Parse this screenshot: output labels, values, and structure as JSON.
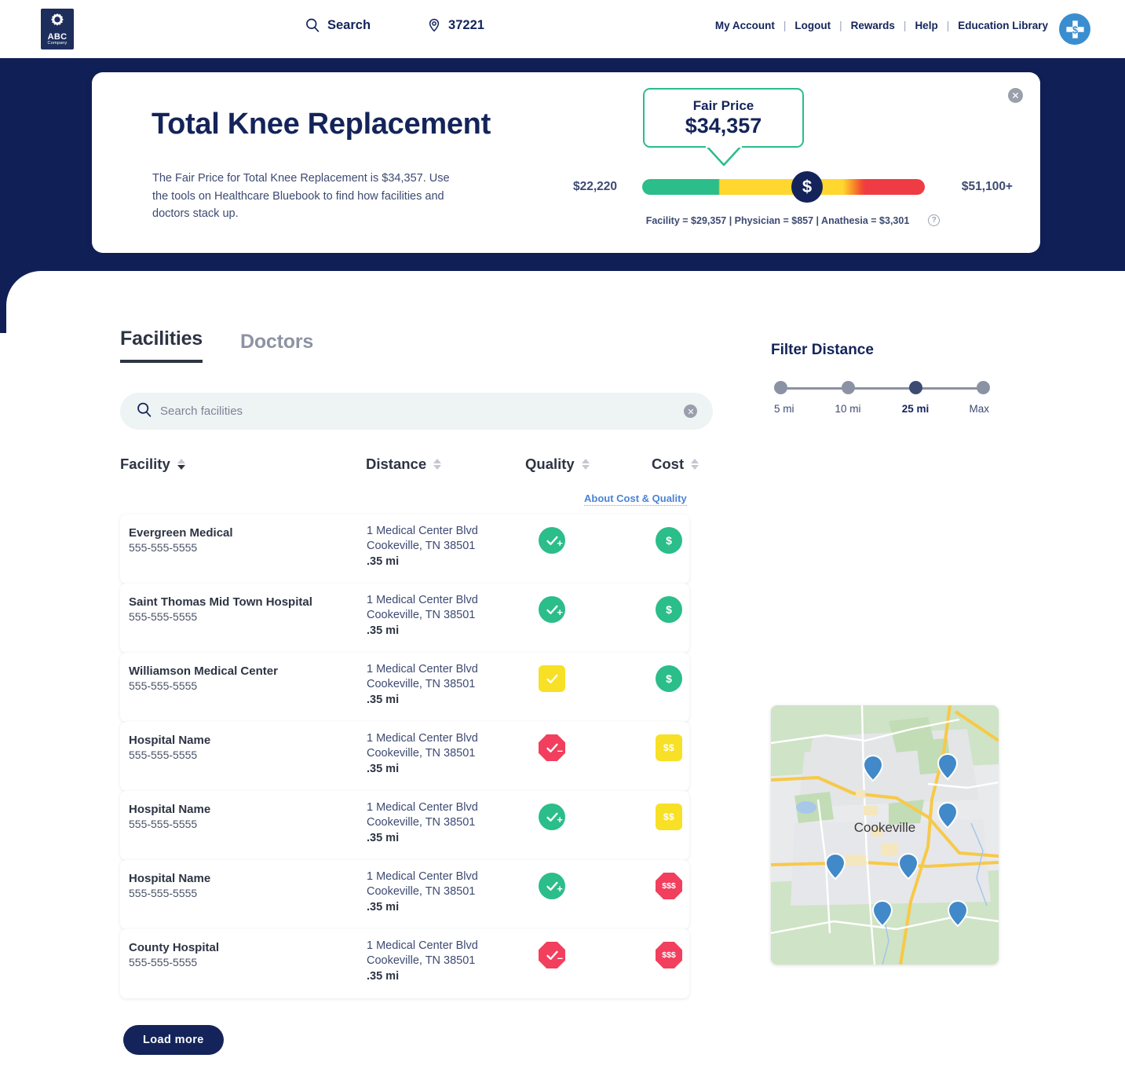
{
  "header": {
    "logo": {
      "name": "ABC",
      "subtitle": "Company",
      "icon": "gear-icon"
    },
    "search_label": "Search",
    "zip": "37221",
    "links": [
      {
        "label": "My Account"
      },
      {
        "label": "Logout"
      },
      {
        "label": "Rewards"
      },
      {
        "label": "Help"
      },
      {
        "label": "Education Library"
      }
    ],
    "separator": "|",
    "brand_badge_icon": "bluebook-dollar-cross-icon"
  },
  "hero": {
    "title": "Total Knee Replacement",
    "description": "The Fair Price for Total Knee Replacement is $34,357. Use the tools on Healthcare Bluebook to find how facilities and doctors stack up.",
    "close_icon": "close-icon",
    "fair_price": {
      "label": "Fair Price",
      "value": "$34,357"
    },
    "price_bar": {
      "min": "$22,220",
      "max": "$51,100+",
      "knob_icon": "dollar-icon",
      "knob_position_pct": 27,
      "colors": {
        "green": "#2bbd8a",
        "yellow": "#ffd72e",
        "orange": "#fb9a2a",
        "red": "#ef3b43"
      }
    },
    "breakdown": "Facility = $29,357  |  Physician = $857  | Anathesia = $3,301",
    "help_icon_char": "?"
  },
  "main": {
    "tabs": [
      {
        "label": "Facilities",
        "active": true
      },
      {
        "label": "Doctors",
        "active": false
      }
    ],
    "search": {
      "placeholder": "Search facilities",
      "value": "",
      "icon": "search-icon",
      "clear_icon": "clear-icon"
    },
    "table": {
      "columns": [
        {
          "label": "Facility",
          "sort": "desc"
        },
        {
          "label": "Distance",
          "sort": "none"
        },
        {
          "label": "Quality",
          "sort": "none"
        },
        {
          "label": "Cost",
          "sort": "none"
        }
      ],
      "about_link": "About Cost & Quality",
      "rows": [
        {
          "name": "Evergreen Medical",
          "phone": "555-555-5555",
          "address_line1": "1 Medical Center Blvd",
          "address_line2": "Cookeville, TN 38501",
          "distance": ".35 mi",
          "quality": {
            "color": "green",
            "shape": "circle",
            "mark": "check-plus",
            "icon": "quality-green-icon"
          },
          "cost": {
            "color": "green",
            "shape": "circle",
            "text": "$",
            "icon": "cost-green-icon"
          }
        },
        {
          "name": "Saint Thomas Mid Town Hospital",
          "phone": "555-555-5555",
          "address_line1": "1 Medical Center Blvd",
          "address_line2": "Cookeville, TN 38501",
          "distance": ".35 mi",
          "quality": {
            "color": "green",
            "shape": "circle",
            "mark": "check-plus",
            "icon": "quality-green-icon"
          },
          "cost": {
            "color": "green",
            "shape": "circle",
            "text": "$",
            "icon": "cost-green-icon"
          }
        },
        {
          "name": "Williamson Medical Center",
          "phone": "555-555-5555",
          "address_line1": "1 Medical Center Blvd",
          "address_line2": "Cookeville, TN 38501",
          "distance": ".35 mi",
          "quality": {
            "color": "yellow",
            "shape": "square",
            "mark": "check",
            "icon": "quality-yellow-icon"
          },
          "cost": {
            "color": "green",
            "shape": "circle",
            "text": "$",
            "icon": "cost-green-icon"
          }
        },
        {
          "name": "Hospital Name",
          "phone": "555-555-5555",
          "address_line1": "1 Medical Center Blvd",
          "address_line2": "Cookeville, TN 38501",
          "distance": ".35 mi",
          "quality": {
            "color": "red",
            "shape": "octagon",
            "mark": "check-minus",
            "icon": "quality-red-icon"
          },
          "cost": {
            "color": "yellow",
            "shape": "square",
            "text": "$$",
            "icon": "cost-yellow-icon"
          }
        },
        {
          "name": "Hospital Name",
          "phone": "555-555-5555",
          "address_line1": "1 Medical Center Blvd",
          "address_line2": "Cookeville, TN 38501",
          "distance": ".35 mi",
          "quality": {
            "color": "green",
            "shape": "circle",
            "mark": "check-plus",
            "icon": "quality-green-icon"
          },
          "cost": {
            "color": "yellow",
            "shape": "square",
            "text": "$$",
            "icon": "cost-yellow-icon"
          }
        },
        {
          "name": "Hospital Name",
          "phone": "555-555-5555",
          "address_line1": "1 Medical Center Blvd",
          "address_line2": "Cookeville, TN 38501",
          "distance": ".35 mi",
          "quality": {
            "color": "green",
            "shape": "circle",
            "mark": "check-plus",
            "icon": "quality-green-icon"
          },
          "cost": {
            "color": "red",
            "shape": "octagon",
            "text": "$$$",
            "icon": "cost-red-icon"
          }
        },
        {
          "name": "County Hospital",
          "phone": "555-555-5555",
          "address_line1": "1 Medical Center Blvd",
          "address_line2": "Cookeville, TN 38501",
          "distance": ".35 mi",
          "quality": {
            "color": "red",
            "shape": "octagon",
            "mark": "check-minus",
            "icon": "quality-red-icon"
          },
          "cost": {
            "color": "red",
            "shape": "octagon",
            "text": "$$$",
            "icon": "cost-red-icon"
          }
        }
      ]
    },
    "load_more_label": "Load  more"
  },
  "rail": {
    "filter_title": "Filter Distance",
    "distance_options": [
      {
        "label": "5 mi",
        "active": false
      },
      {
        "label": "10 mi",
        "active": false
      },
      {
        "label": "25 mi",
        "active": true
      },
      {
        "label": "Max",
        "active": false
      }
    ],
    "map": {
      "city_label": "Cookeville",
      "pin_count": 7,
      "pin_color": "#4189c8"
    }
  }
}
